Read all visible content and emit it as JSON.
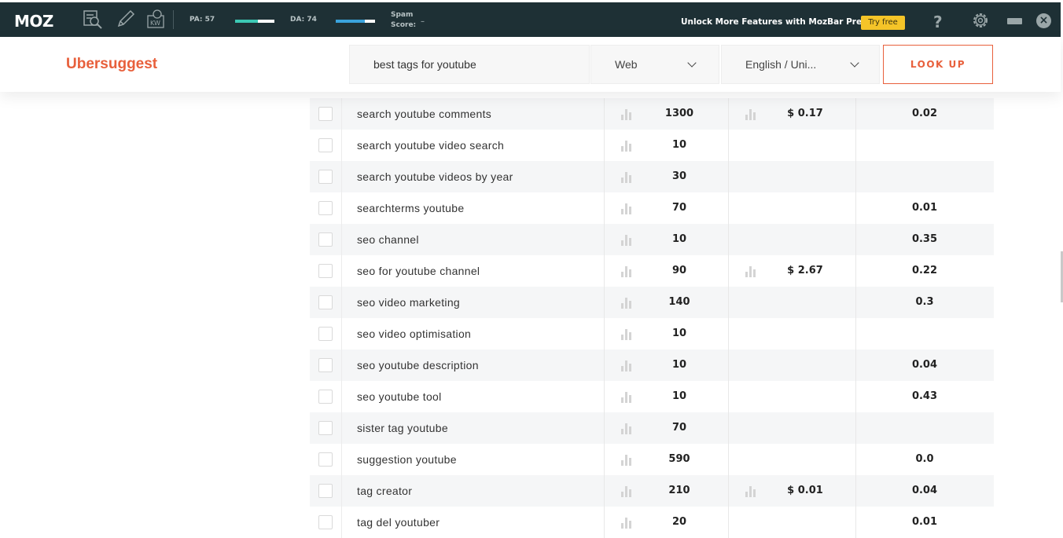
{
  "mozbar": {
    "logo": "MOZ",
    "pa_label": "PA: 57",
    "pa_value": 57,
    "da_label": "DA: 74",
    "da_value": 74,
    "spam_label_1": "Spam",
    "spam_label_2": "Score:",
    "spam_value": "–",
    "premium_text": "Unlock More Features with MozBar Premium",
    "try_free": "Try free",
    "help": "?",
    "close": "×",
    "colors": {
      "bar_bg": "#1e3035",
      "pa_fill": "#3cc9b4",
      "da_fill": "#3aa3dc",
      "try_free_bg": "#f5c428"
    }
  },
  "header": {
    "brand": "Ubersuggest",
    "search_value": "best tags for youtube",
    "source_select": "Web",
    "language_select": "English / Uni...",
    "lookup_button": "LOOK UP",
    "accent": "#e8603c"
  },
  "rows": [
    {
      "keyword": "search youtube comments",
      "volume": "1300",
      "cpc": "$ 0.17",
      "competition": "0.02"
    },
    {
      "keyword": "search youtube video search",
      "volume": "10",
      "cpc": "",
      "competition": ""
    },
    {
      "keyword": "search youtube videos by year",
      "volume": "30",
      "cpc": "",
      "competition": ""
    },
    {
      "keyword": "searchterms youtube",
      "volume": "70",
      "cpc": "",
      "competition": "0.01"
    },
    {
      "keyword": "seo channel",
      "volume": "10",
      "cpc": "",
      "competition": "0.35"
    },
    {
      "keyword": "seo for youtube channel",
      "volume": "90",
      "cpc": "$ 2.67",
      "competition": "0.22"
    },
    {
      "keyword": "seo video marketing",
      "volume": "140",
      "cpc": "",
      "competition": "0.3"
    },
    {
      "keyword": "seo video optimisation",
      "volume": "10",
      "cpc": "",
      "competition": ""
    },
    {
      "keyword": "seo youtube description",
      "volume": "10",
      "cpc": "",
      "competition": "0.04"
    },
    {
      "keyword": "seo youtube tool",
      "volume": "10",
      "cpc": "",
      "competition": "0.43"
    },
    {
      "keyword": "sister tag youtube",
      "volume": "70",
      "cpc": "",
      "competition": ""
    },
    {
      "keyword": "suggestion youtube",
      "volume": "590",
      "cpc": "",
      "competition": "0.0"
    },
    {
      "keyword": "tag creator",
      "volume": "210",
      "cpc": "$ 0.01",
      "competition": "0.04"
    },
    {
      "keyword": "tag del youtuber",
      "volume": "20",
      "cpc": "",
      "competition": "0.01"
    }
  ]
}
